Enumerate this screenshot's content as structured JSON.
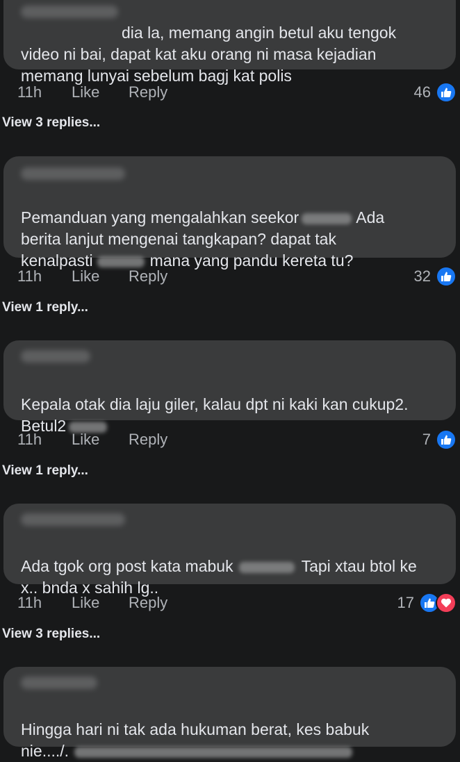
{
  "colors": {
    "background": "#18191a",
    "bubble": "#3a3b3c",
    "like_blue": "#1877f2",
    "love_red": "#f33e58"
  },
  "comments": [
    {
      "name_redacted": true,
      "text_lines": [
        "dia la, memang angin betul aku tengok",
        "video ni bai, dapat kat aku orang ni masa kejadian",
        "memang lunyai sebelum bagj kat polis"
      ],
      "time": "11h",
      "like_label": "Like",
      "reply_label": "Reply",
      "reaction_count": "46",
      "reactions": [
        "like-icon"
      ],
      "view_replies": "View 3 replies..."
    },
    {
      "name_redacted": true,
      "text_lines": [
        "Pemanduan yang mengalahkan seekor",
        "Ada",
        "berita lanjut mengenai tangkapan? dapat tak",
        "kenalpasti",
        "mana yang pandu kereta tu?"
      ],
      "time": "11h",
      "like_label": "Like",
      "reply_label": "Reply",
      "reaction_count": "32",
      "reactions": [
        "like-icon"
      ],
      "view_replies": "View 1 reply..."
    },
    {
      "name_redacted": true,
      "text_lines": [
        "Kepala otak dia laju giler, kalau dpt ni kaki kan cukup2.",
        "Betul2"
      ],
      "time": "11h",
      "like_label": "Like",
      "reply_label": "Reply",
      "reaction_count": "7",
      "reactions": [
        "like-icon"
      ],
      "view_replies": "View 1 reply..."
    },
    {
      "name_redacted": true,
      "text_lines": [
        "Ada tgok org post kata mabuk",
        "Tapi xtau btol ke",
        "x.. bnda x sahih lg.."
      ],
      "time": "11h",
      "like_label": "Like",
      "reply_label": "Reply",
      "reaction_count": "17",
      "reactions": [
        "like-icon",
        "love-icon"
      ],
      "view_replies": "View 3 replies..."
    },
    {
      "name_redacted": true,
      "text_lines": [
        "Hingga hari ni tak ada hukuman berat, kes babuk",
        "nie..../."
      ]
    }
  ]
}
